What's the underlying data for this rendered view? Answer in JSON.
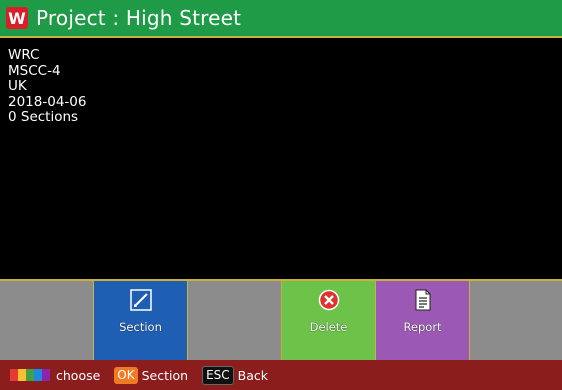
{
  "header": {
    "title": "Project : High Street",
    "logo_letter": "W",
    "accent": "#1f9a47"
  },
  "info_lines": [
    "WRC",
    "MSCC-4",
    "UK",
    "2018-04-06",
    "0 Sections"
  ],
  "toolbar": {
    "buttons": [
      {
        "label": "",
        "color": "#8c8c8c"
      },
      {
        "label": "Section",
        "icon": "edit-icon",
        "color": "#1e5fb3"
      },
      {
        "label": "",
        "color": "#8c8c8c"
      },
      {
        "label": "Delete",
        "icon": "delete-icon",
        "color": "#6dc249"
      },
      {
        "label": "Report",
        "icon": "report-icon",
        "color": "#9b58b4"
      },
      {
        "label": "",
        "color": "#8c8c8c"
      }
    ]
  },
  "footer": {
    "choose_label": "choose",
    "ok_key": "OK",
    "ok_label": "Section",
    "esc_key": "ESC",
    "esc_label": "Back",
    "swatch_colors": [
      "#e53935",
      "#fbc02d",
      "#43a047",
      "#1e88e5",
      "#8e24aa"
    ]
  }
}
